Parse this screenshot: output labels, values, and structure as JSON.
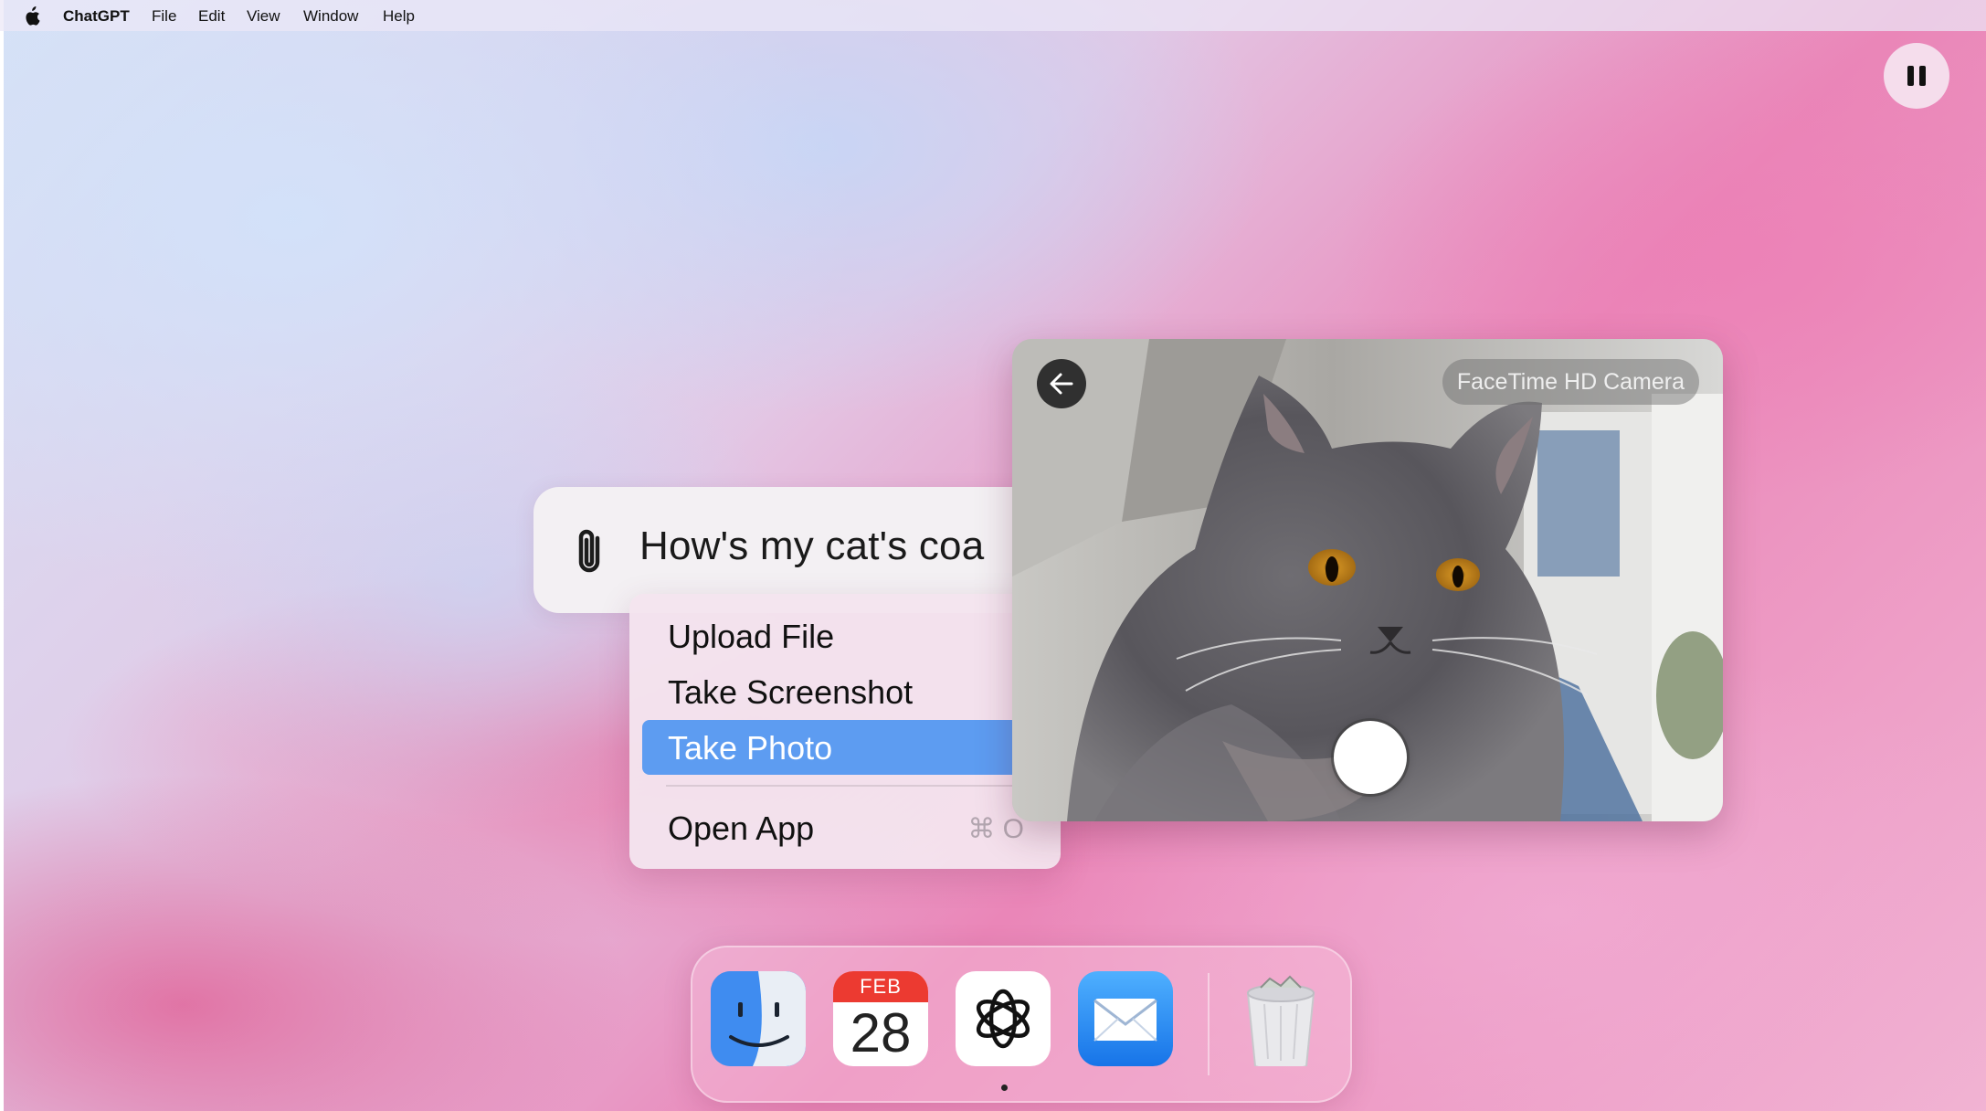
{
  "menubar": {
    "app_name": "ChatGPT",
    "items": [
      "File",
      "Edit",
      "View",
      "Window",
      "Help"
    ]
  },
  "prompt": {
    "text": "How's my cat's coa"
  },
  "attach_menu": {
    "items": [
      {
        "label": "Upload File",
        "selected": false
      },
      {
        "label": "Take Screenshot",
        "selected": false
      },
      {
        "label": "Take Photo",
        "selected": true
      }
    ],
    "open_app": {
      "label": "Open App",
      "shortcut": "⌘ O"
    },
    "selected_color": "#5d9cf1"
  },
  "camera": {
    "label": "FaceTime HD Camera"
  },
  "dock": {
    "apps": [
      "finder-icon",
      "calendar-icon",
      "chatgpt-icon",
      "mail-icon",
      "trash-icon"
    ],
    "calendar": {
      "month": "FEB",
      "day": "28"
    },
    "running_app": "ChatGPT"
  },
  "colors": {
    "menu_highlight": "#5d9cf1",
    "calendar_red": "#ec3a31"
  }
}
